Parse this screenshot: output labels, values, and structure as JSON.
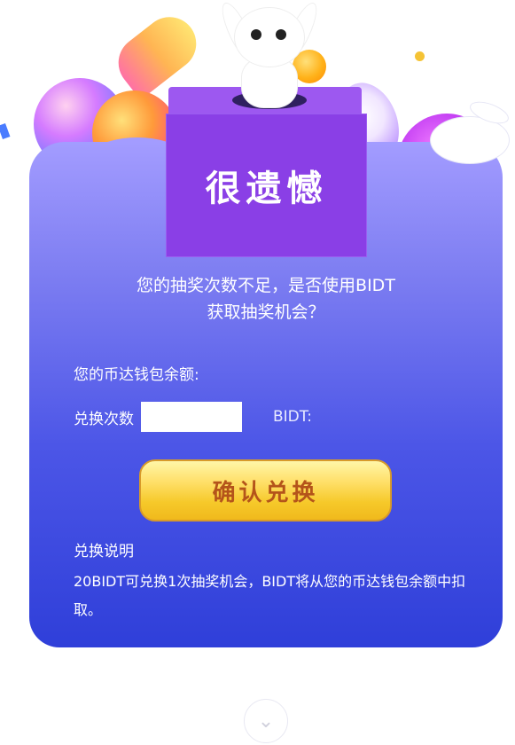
{
  "box": {
    "title": "很遗憾"
  },
  "message": {
    "line1": "您的抽奖次数不足，是否使用BIDT",
    "line2": "获取抽奖机会？"
  },
  "wallet": {
    "balance_label": "您的币达钱包余额:"
  },
  "exchange": {
    "count_label": "兑换次数",
    "count_value": "",
    "bidt_label": "BIDT:"
  },
  "confirm_button": {
    "label": "确认兑换"
  },
  "description": {
    "title": "兑换说明",
    "text": "20BIDT可兑换1次抽奖机会，BIDT将从您的币达钱包余额中扣取。"
  },
  "icons": {
    "scroll_down": "chevron-down-icon",
    "mascot": "bunny-icon",
    "sleeping_rabbit": "rabbit-icon"
  }
}
